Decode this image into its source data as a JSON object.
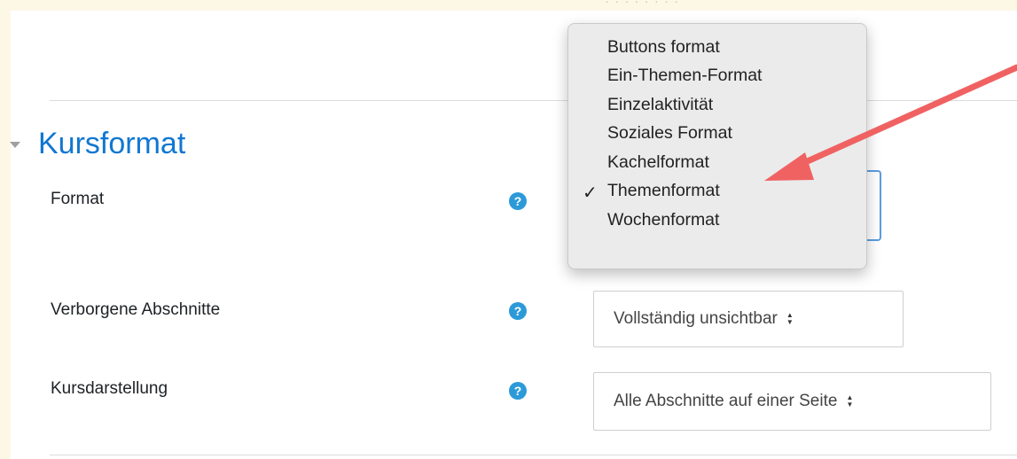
{
  "section": {
    "title": "Kursformat"
  },
  "fields": [
    {
      "label": "Format"
    },
    {
      "label": "Verborgene Abschnitte",
      "value": "Vollständig unsichtbar"
    },
    {
      "label": "Kursdarstellung",
      "value": "Alle Abschnitte auf einer Seite"
    }
  ],
  "dropdown": {
    "options": [
      "Buttons format",
      "Ein-Themen-Format",
      "Einzelaktivität",
      "Soziales Format",
      "Kachelformat",
      "Themenformat",
      "Wochenformat"
    ],
    "selected": "Themenformat"
  },
  "help_icon_glyph": "?",
  "select_arrows": [
    "▲",
    "▼"
  ],
  "colors": {
    "accent": "#1177d1",
    "help_icon": "#2c9ad8",
    "annotation_arrow": "#f06262",
    "page_border": "#fdf8e6"
  }
}
